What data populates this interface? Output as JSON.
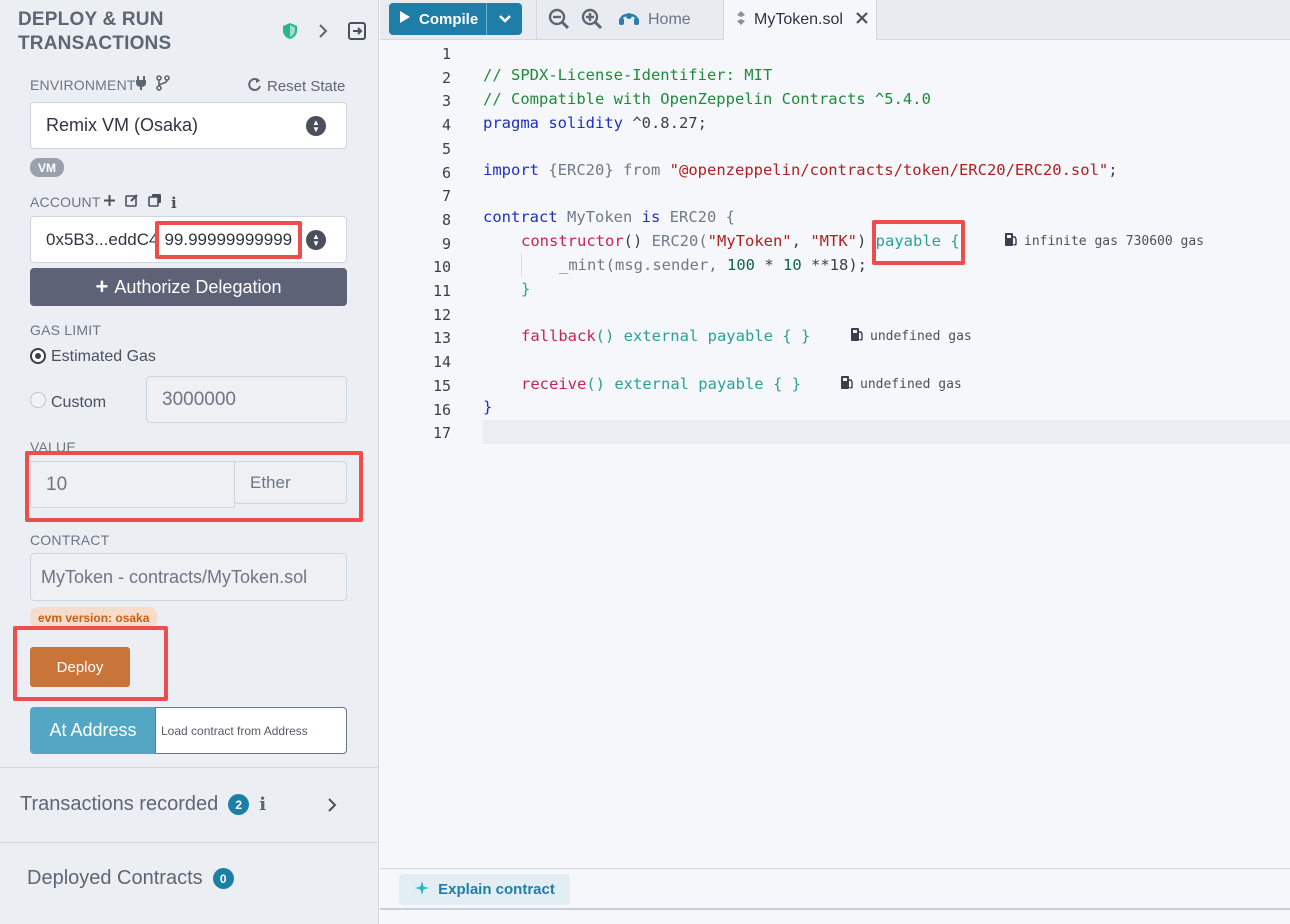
{
  "panel": {
    "title_line1": "DEPLOY & RUN",
    "title_line2": "TRANSACTIONS",
    "environment_label": "ENVIRONMENT",
    "reset_state": "Reset State",
    "environment_value": "Remix VM (Osaka)",
    "vm_badge": "VM",
    "account_label": "ACCOUNT",
    "account_address": "0x5B3...eddC4",
    "account_balance": "99.99999999999",
    "authorize_delegation": "Authorize Delegation",
    "gas_limit_label": "GAS LIMIT",
    "estimated_gas": "Estimated Gas",
    "custom": "Custom",
    "custom_gas_value": "3000000",
    "value_label": "VALUE",
    "value_amount": "10",
    "value_unit": "Ether",
    "contract_label": "CONTRACT",
    "contract_value": "MyToken - contracts/MyToken.sol",
    "evm_version": "evm version: osaka",
    "deploy": "Deploy",
    "at_address": "At Address",
    "load_contract_placeholder": "Load contract from Address",
    "transactions_recorded": "Transactions recorded",
    "transactions_count": "2",
    "deployed_contracts": "Deployed Contracts",
    "deployed_count": "0"
  },
  "topbar": {
    "compile": "Compile",
    "home_tab": "Home",
    "file_tab": "MyToken.sol"
  },
  "editor": {
    "line_numbers": [
      "1",
      "2",
      "3",
      "4",
      "5",
      "6",
      "7",
      "8",
      "9",
      "10",
      "11",
      "12",
      "13",
      "14",
      "15",
      "16",
      "17"
    ],
    "l2": "// SPDX-License-Identifier: MIT",
    "l3": "// Compatible with OpenZeppelin Contracts ^5.4.0",
    "l4_kw": "pragma solidity",
    "l4_ver": " ^0.8.27;",
    "l6_import": "import",
    "l6_brace": " {ERC20} ",
    "l6_from": "from",
    "l6_path": " \"@openzeppelin/contracts/token/ERC20/ERC20.sol\"",
    "l6_end": ";",
    "l8_contract": "contract",
    "l8_name": " MyToken ",
    "l8_is": "is",
    "l8_rest": " ERC20 {",
    "l9_ctor": "constructor",
    "l9_paren": "() ",
    "l9_erc": "ERC20(",
    "l9_s1": "\"MyToken\"",
    "l9_comma": ", ",
    "l9_s2": "\"MTK\"",
    "l9_close": ") ",
    "l9_payable": "payable",
    "l9_brace": " {",
    "l9_gas": "infinite gas 730600 gas",
    "l10_mint": "_mint(msg.sender, ",
    "l10_n1": "100",
    "l10_mul": " * ",
    "l10_n2": "10",
    "l10_pow": " **18);",
    "l11": "}",
    "l13_fn": "fallback",
    "l13_rest": "() external payable { }",
    "l13_gas": "undefined gas",
    "l15_fn": "receive",
    "l15_rest": "() external payable { }",
    "l15_gas": "undefined gas",
    "l16": "}"
  },
  "bottom": {
    "explain_contract": "Explain contract"
  },
  "colors": {
    "accent_blue": "#1f7ea8",
    "deploy_orange": "#c97539",
    "highlight_red": "#ee4d4d",
    "at_address_blue": "#53a6c4"
  }
}
